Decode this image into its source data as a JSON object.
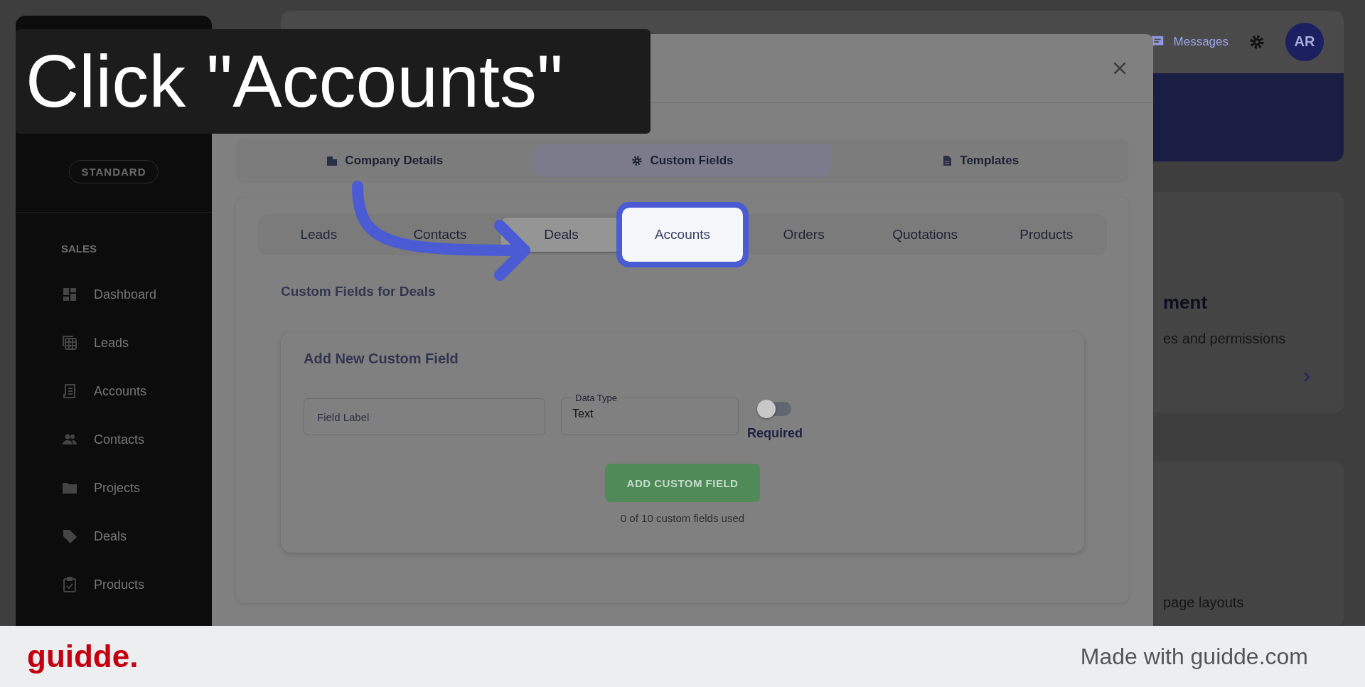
{
  "caption": {
    "text": "Click \"Accounts\""
  },
  "sidebar": {
    "plan": "STANDARD",
    "section": "SALES",
    "items": [
      {
        "label": "Dashboard"
      },
      {
        "label": "Leads"
      },
      {
        "label": "Accounts"
      },
      {
        "label": "Contacts"
      },
      {
        "label": "Projects"
      },
      {
        "label": "Deals"
      },
      {
        "label": "Products"
      }
    ]
  },
  "topbar": {
    "messages": "Messages",
    "avatar": "AR"
  },
  "background_card": {
    "title": "ment",
    "subtitle": "es and permissions"
  },
  "background_card_2": {
    "text": "page layouts"
  },
  "modal": {
    "tabs": [
      {
        "label": "Company Details",
        "selected": false
      },
      {
        "label": "Custom Fields",
        "selected": true
      },
      {
        "label": "Templates",
        "selected": false
      }
    ],
    "subtabs": [
      {
        "label": "Leads",
        "selected": false,
        "highlighted": false
      },
      {
        "label": "Contacts",
        "selected": false,
        "highlighted": false
      },
      {
        "label": "Deals",
        "selected": true,
        "highlighted": false
      },
      {
        "label": "Accounts",
        "selected": false,
        "highlighted": true
      },
      {
        "label": "Orders",
        "selected": false,
        "highlighted": false
      },
      {
        "label": "Quotations",
        "selected": false,
        "highlighted": false
      },
      {
        "label": "Products",
        "selected": false,
        "highlighted": false
      }
    ],
    "section_title": "Custom Fields for Deals",
    "form": {
      "title": "Add New Custom Field",
      "label_field": {
        "placeholder": "Field Label"
      },
      "type_field": {
        "label": "Data Type",
        "value": "Text"
      },
      "required": {
        "label": "Required",
        "on": false
      },
      "button": "ADD CUSTOM FIELD",
      "usage": "0 of 10 custom fields used"
    }
  },
  "footer": {
    "brand": "guidde.",
    "credit": "Made with guidde.com"
  }
}
